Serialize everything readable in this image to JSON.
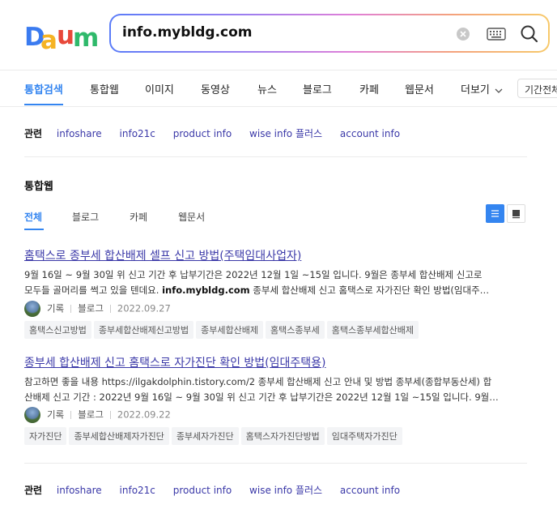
{
  "search": {
    "query": "info.mybldg.com"
  },
  "tabs": [
    {
      "label": "통합검색"
    },
    {
      "label": "통합웹"
    },
    {
      "label": "이미지"
    },
    {
      "label": "동영상"
    },
    {
      "label": "뉴스"
    },
    {
      "label": "블로그"
    },
    {
      "label": "카페"
    },
    {
      "label": "웹문서"
    },
    {
      "label": "더보기"
    }
  ],
  "period_label": "기간전체",
  "related_top": {
    "label": "관련",
    "keywords": [
      "infoshare",
      "info21c",
      "product info",
      "wise info 플러스",
      "account info"
    ]
  },
  "section": {
    "title": "통합웹",
    "subtabs": [
      "전체",
      "블로그",
      "카페",
      "웹문서"
    ]
  },
  "results": [
    {
      "title": "홈택스로 종부세 합산배제 셀프 신고 방법(주택임대사업자)",
      "snippet_line1": "9월 16일 ~ 9월 30일 위 신고 기간 후 납부기간은 2022년 12월 1일 ~15일 입니다. 9월은 종부세 합산배제 신고로",
      "snippet_line2_pre": "모두들 골머리를 썩고 있을 텐데요. ",
      "snippet_line2_bold": "info.mybldg.com",
      "snippet_line2_post": " 종부세 합산배제 신고 홈택스로 자가진단 확인 방법(임대주…",
      "author": "기록",
      "source": "블로그",
      "date": "2022.09.27",
      "tags": [
        "홈택스신고방법",
        "종부세합산배제신고방법",
        "종부세합산배제",
        "홈택스종부세",
        "홈택스종부세합산배제"
      ]
    },
    {
      "title": "종부세 합산배제 신고 홈택스로 자가진단 확인 방법(임대주택용)",
      "snippet_line1": "참고하면 좋을 내용 https://ilgakdolphin.tistory.com/2 종부세 합산배제 신고 안내 및 방법 종부세(종합부동산세) 합",
      "snippet_line2": "산배제 신고 기간 : 2022년 9월 16일 ~ 9월 30일 위 신고 기간 후 납부기간은 2022년 12월 1일 ~15일 입니다. 9월…",
      "author": "기록",
      "source": "블로그",
      "date": "2022.09.22",
      "tags": [
        "자가진단",
        "종부세합산배제자가진단",
        "종부세자가진단",
        "홈택스자가진단방법",
        "임대주택자가진단"
      ]
    }
  ],
  "related_bottom": {
    "label": "관련",
    "keywords": [
      "infoshare",
      "info21c",
      "product info",
      "wise info 플러스",
      "account info"
    ]
  },
  "colors": {
    "accent": "#3485f0",
    "link": "#3b39a8"
  },
  "icons": [
    "daum-logo",
    "clear-icon",
    "keyboard-icon",
    "search-icon",
    "chevron-down-icon",
    "list-view-icon",
    "card-view-icon"
  ]
}
